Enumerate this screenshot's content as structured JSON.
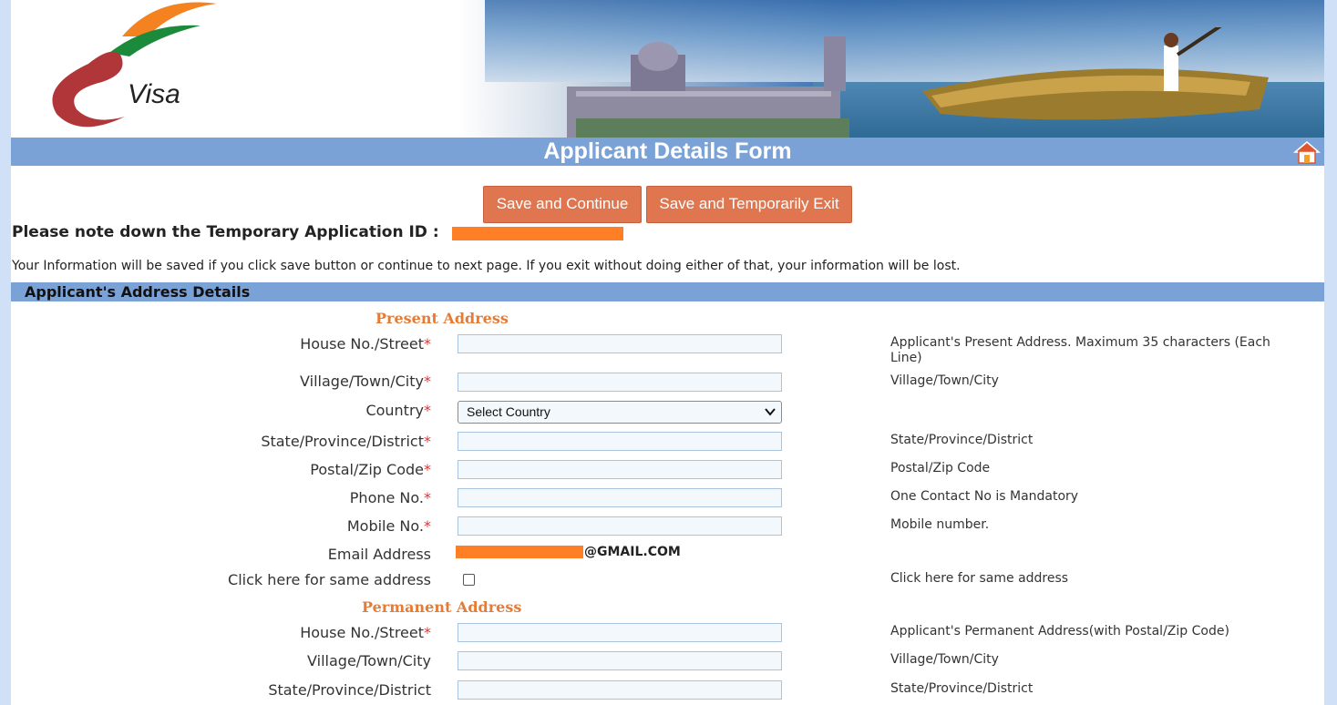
{
  "header": {
    "logo_text": "Visa",
    "title": "Applicant Details Form"
  },
  "buttons": {
    "save_continue": "Save and Continue",
    "save_exit": "Save and Temporarily Exit"
  },
  "notice": {
    "temp_id_label": "Please note down the Temporary Application ID :",
    "info": "Your Information will be saved if you click save button or continue to next page. If you exit without doing either of that, your information will be lost."
  },
  "section": {
    "title": "Applicant's Address Details"
  },
  "present": {
    "heading": "Present Address",
    "house_label": "House No./Street",
    "house_help": "Applicant's Present Address. Maximum 35 characters (Each Line)",
    "village_label": "Village/Town/City",
    "village_help": "Village/Town/City",
    "country_label": "Country",
    "country_value": "Select Country",
    "state_label": "State/Province/District",
    "state_help": "State/Province/District",
    "postal_label": "Postal/Zip Code",
    "postal_help": "Postal/Zip Code",
    "phone_label": "Phone No.",
    "phone_help": "One Contact No is Mandatory",
    "mobile_label": "Mobile No.",
    "mobile_help": "Mobile number.",
    "email_label": "Email Address",
    "email_suffix": "@GMAIL.COM",
    "same_label": "Click here for same address",
    "same_help": "Click here for same address"
  },
  "permanent": {
    "heading": "Permanent Address",
    "house_label": "House No./Street",
    "house_help": "Applicant's Permanent Address(with Postal/Zip Code)",
    "village_label": "Village/Town/City",
    "village_help": "Village/Town/City",
    "state_label": "State/Province/District",
    "state_help": "State/Province/District"
  },
  "required_mark": "*",
  "colors": {
    "accent_bar": "#7aa2d6",
    "button": "#e0764f",
    "subheading": "#e57b35",
    "redaction": "#ff7f27"
  }
}
